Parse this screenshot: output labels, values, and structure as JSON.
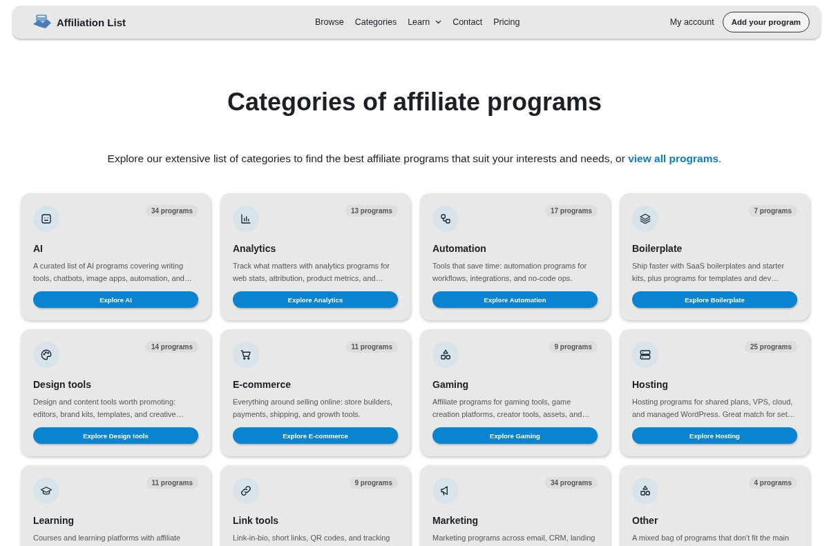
{
  "header": {
    "logo": "Affiliation List",
    "nav": [
      {
        "label": "Browse",
        "dropdown": false
      },
      {
        "label": "Categories",
        "dropdown": false
      },
      {
        "label": "Learn",
        "dropdown": true
      },
      {
        "label": "Contact",
        "dropdown": false
      },
      {
        "label": "Pricing",
        "dropdown": false
      }
    ],
    "account": "My account",
    "cta": "Add your program"
  },
  "title": "Categories of affiliate programs",
  "intro": {
    "text": "Explore our extensive list of categories to find the best affiliate programs that suit your interests and needs, or",
    "link": "view all programs",
    "end": "."
  },
  "categories": [
    {
      "kind": "robot",
      "count": "34 programs",
      "name": "AI",
      "description": "A curated list of AI programs covering writing tools, chatbots, image apps, automation, and…",
      "button": "Explore AI"
    },
    {
      "kind": "chart",
      "count": "13 programs",
      "name": "Analytics",
      "description": "Track what matters with analytics programs for web stats, attribution, product metrics, and…",
      "button": "Explore Analytics"
    },
    {
      "kind": "flow",
      "count": "17 programs",
      "name": "Automation",
      "description": "Tools that save time: automation programs for workflows, integrations, and no-code ops.",
      "button": "Explore Automation"
    },
    {
      "kind": "layers",
      "count": "7 programs",
      "name": "Boilerplate",
      "description": "Ship faster with SaaS boilerplates and starter kits, plus programs for templates and dev…",
      "button": "Explore Boilerplate"
    },
    {
      "kind": "palette",
      "count": "14 programs",
      "name": "Design tools",
      "description": "Design and content tools worth promoting: editors, brand kits, templates, and creative…",
      "button": "Explore Design tools"
    },
    {
      "kind": "cart",
      "count": "11 programs",
      "name": "E-commerce",
      "description": "Everything around selling online: store builders, payments, shipping, and growth tools.",
      "button": "Explore E-commerce"
    },
    {
      "kind": "shapes",
      "count": "9 programs",
      "name": "Gaming",
      "description": "Affiliate programs for gaming tools, game creation platforms, creator tools, assets, and…",
      "button": "Explore Gaming"
    },
    {
      "kind": "server",
      "count": "25 programs",
      "name": "Hosting",
      "description": "Hosting programs for shared plans, VPS, cloud, and managed WordPress. Great match for set…",
      "button": "Explore Hosting"
    },
    {
      "kind": "cap",
      "count": "11 programs",
      "name": "Learning",
      "description": "Courses and learning platforms with affiliate"
    },
    {
      "kind": "link",
      "count": "9 programs",
      "name": "Link tools",
      "description": "Link-in-bio, short links, QR codes, and tracking"
    },
    {
      "kind": "megaphone",
      "count": "34 programs",
      "name": "Marketing",
      "description": "Marketing programs across email, CRM, landing"
    },
    {
      "kind": "shapes",
      "count": "4 programs",
      "name": "Other",
      "description": "A mixed bag of programs that don't fit the main"
    }
  ]
}
